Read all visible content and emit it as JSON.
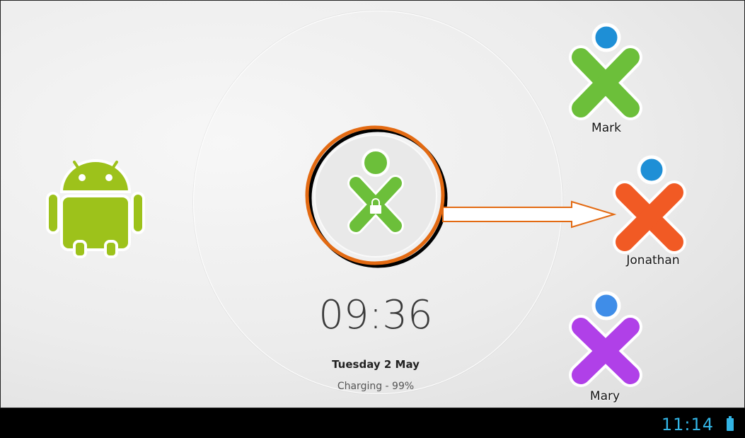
{
  "lockscreen": {
    "time": "09:36",
    "date": "Tuesday 2 May",
    "charging_status": "Charging - 99%"
  },
  "users": [
    {
      "name": "Mark",
      "head_color": "#1e8fd6",
      "body_color": "#6cbf3a"
    },
    {
      "name": "Jonathan",
      "head_color": "#1e8fd6",
      "body_color": "#f15a24"
    },
    {
      "name": "Mary",
      "head_color": "#3f8de8",
      "body_color": "#b040e8"
    }
  ],
  "current_user": {
    "head_color": "#6cbf3a",
    "body_color": "#6cbf3a",
    "icon": "lock-icon"
  },
  "highlight_color": "#e36a12",
  "android_color": "#9dc21b",
  "status_bar": {
    "time": "11:14",
    "accent": "#33b5e5"
  }
}
